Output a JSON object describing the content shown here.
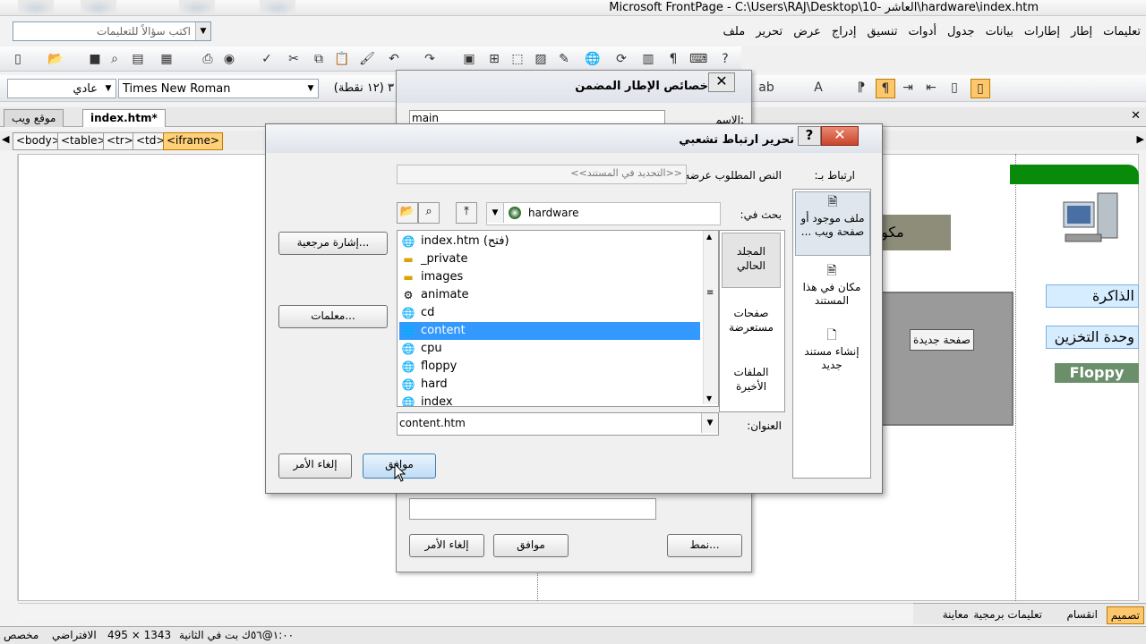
{
  "window": {
    "title": "Microsoft FrontPage - C:\\Users\\RAJ\\Desktop\\10- العاشر\\hardware\\index.htm"
  },
  "ask_box": {
    "placeholder": "اكتب سؤالاً للتعليمات"
  },
  "menu": [
    "ملف",
    "تحرير",
    "عرض",
    "إدراج",
    "تنسيق",
    "أدوات",
    "جدول",
    "بيانات",
    "إطارات",
    "إطار",
    "تعليمات"
  ],
  "format_bar": {
    "style": "عادي",
    "font": "Times New Roman",
    "size": "٣ (١٢ نقطة)"
  },
  "tabs": [
    {
      "label": "موقع ويب"
    },
    {
      "label": "index.htm*"
    }
  ],
  "tag_path": [
    "<body>",
    "<table>",
    "<tr>",
    "<td>",
    "<iframe>"
  ],
  "page_content": {
    "nav_memory": "الذاكرة",
    "nav_storage": "وحدة التخزين",
    "nav_floppy": "Floppy",
    "partial_title": "مكو",
    "new_page_button": "صفحة جديدة"
  },
  "view_tabs": {
    "design": "تصميم",
    "split": "انقسام",
    "code": "تعليمات برمجية",
    "preview": "معاينة"
  },
  "status_bar": {
    "time": "١:٠٠@٥٦ك بت في الثانية",
    "size": "495 × 1343",
    "default": "الافتراضي",
    "custom": "مخصص"
  },
  "iframe_dialog": {
    "title": "خصائص الإطار المضمن",
    "name_label": "الاسم:",
    "name_value": "main",
    "ok": "موافق",
    "cancel": "إلغاء الأمر",
    "style": "نمط..."
  },
  "hyperlink_dialog": {
    "title": "تحرير ارتباط تشعبي",
    "link_to_label": "ارتباط بـ:",
    "link_options": [
      {
        "label": "ملف موجود أو صفحة ويب ..."
      },
      {
        "label": "مكان في هذا المستند"
      },
      {
        "label": "إنشاء مستند جديد"
      }
    ],
    "display_text_label": "النص المطلوب عرضه:",
    "display_text_value": "<<التحديد في المستند>>",
    "look_in_label": "بحث في:",
    "look_in_value": "hardware",
    "side_buttons": [
      {
        "label": "المجلد الحالي"
      },
      {
        "label": "صفحات مستعرضة"
      },
      {
        "label": "الملفات الأخيرة"
      }
    ],
    "files": [
      {
        "name": "index.htm (فتح)",
        "icon": "ie-page-icon"
      },
      {
        "name": "_private",
        "icon": "folder-icon"
      },
      {
        "name": "images",
        "icon": "folder-icon"
      },
      {
        "name": "animate",
        "icon": "script-page-icon"
      },
      {
        "name": "cd",
        "icon": "ie-page-icon"
      },
      {
        "name": "content",
        "icon": "ie-page-icon"
      },
      {
        "name": "cpu",
        "icon": "ie-page-icon"
      },
      {
        "name": "floppy",
        "icon": "ie-page-icon"
      },
      {
        "name": "hard",
        "icon": "ie-page-icon"
      },
      {
        "name": "index",
        "icon": "ie-page-icon"
      }
    ],
    "selected_file": "content",
    "bookmark_button": "إشارة مرجعية...",
    "parameters_button": "معلمات...",
    "address_label": "العنوان:",
    "address_value": "content.htm",
    "ok": "موافق",
    "cancel": "إلغاء الأمر",
    "help_glyph": "?",
    "close_glyph": "✕"
  },
  "colors": {
    "selection": "#3399ff",
    "accent_green": "#0a8a0a",
    "close_red": "#c8452c"
  }
}
